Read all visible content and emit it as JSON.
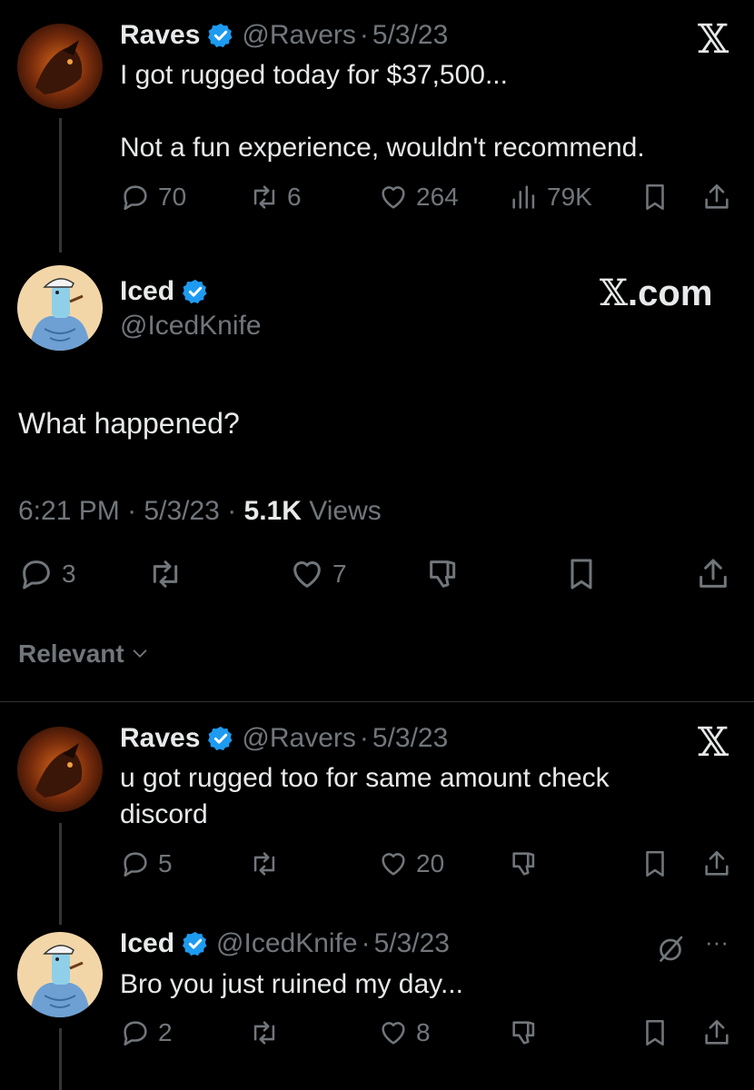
{
  "tweet1": {
    "name": "Raves",
    "handle": "@Ravers",
    "separator": "·",
    "date": "5/3/23",
    "text": "I got rugged today for $37,500...\n\nNot a fun experience, wouldn't recommend.",
    "replies": "70",
    "retweets": "6",
    "likes": "264",
    "views": "79K",
    "logo": "𝕏"
  },
  "main_tweet": {
    "name": "Iced",
    "handle": "@IcedKnife",
    "site_label": ".com",
    "site_logo": "𝕏",
    "text": "What happened?",
    "time": "6:21 PM",
    "date": "5/3/23",
    "views_count": "5.1K",
    "views_label": "Views",
    "separator": "·",
    "replies": "3",
    "likes": "7"
  },
  "sort": {
    "label": "Relevant"
  },
  "reply1": {
    "name": "Raves",
    "handle": "@Ravers",
    "separator": "·",
    "date": "5/3/23",
    "text": "u got rugged too for same amount check\ndiscord",
    "replies": "5",
    "likes": "20",
    "logo": "𝕏"
  },
  "reply2": {
    "name": "Iced",
    "handle": "@IcedKnife",
    "separator": "·",
    "date": "5/3/23",
    "text": "Bro you just ruined my day...",
    "replies": "2",
    "likes": "8",
    "more": "···"
  },
  "colors": {
    "background": "#000000",
    "text": "#e7e9ea",
    "muted": "#71767b",
    "verified": "#1d9bf0"
  }
}
